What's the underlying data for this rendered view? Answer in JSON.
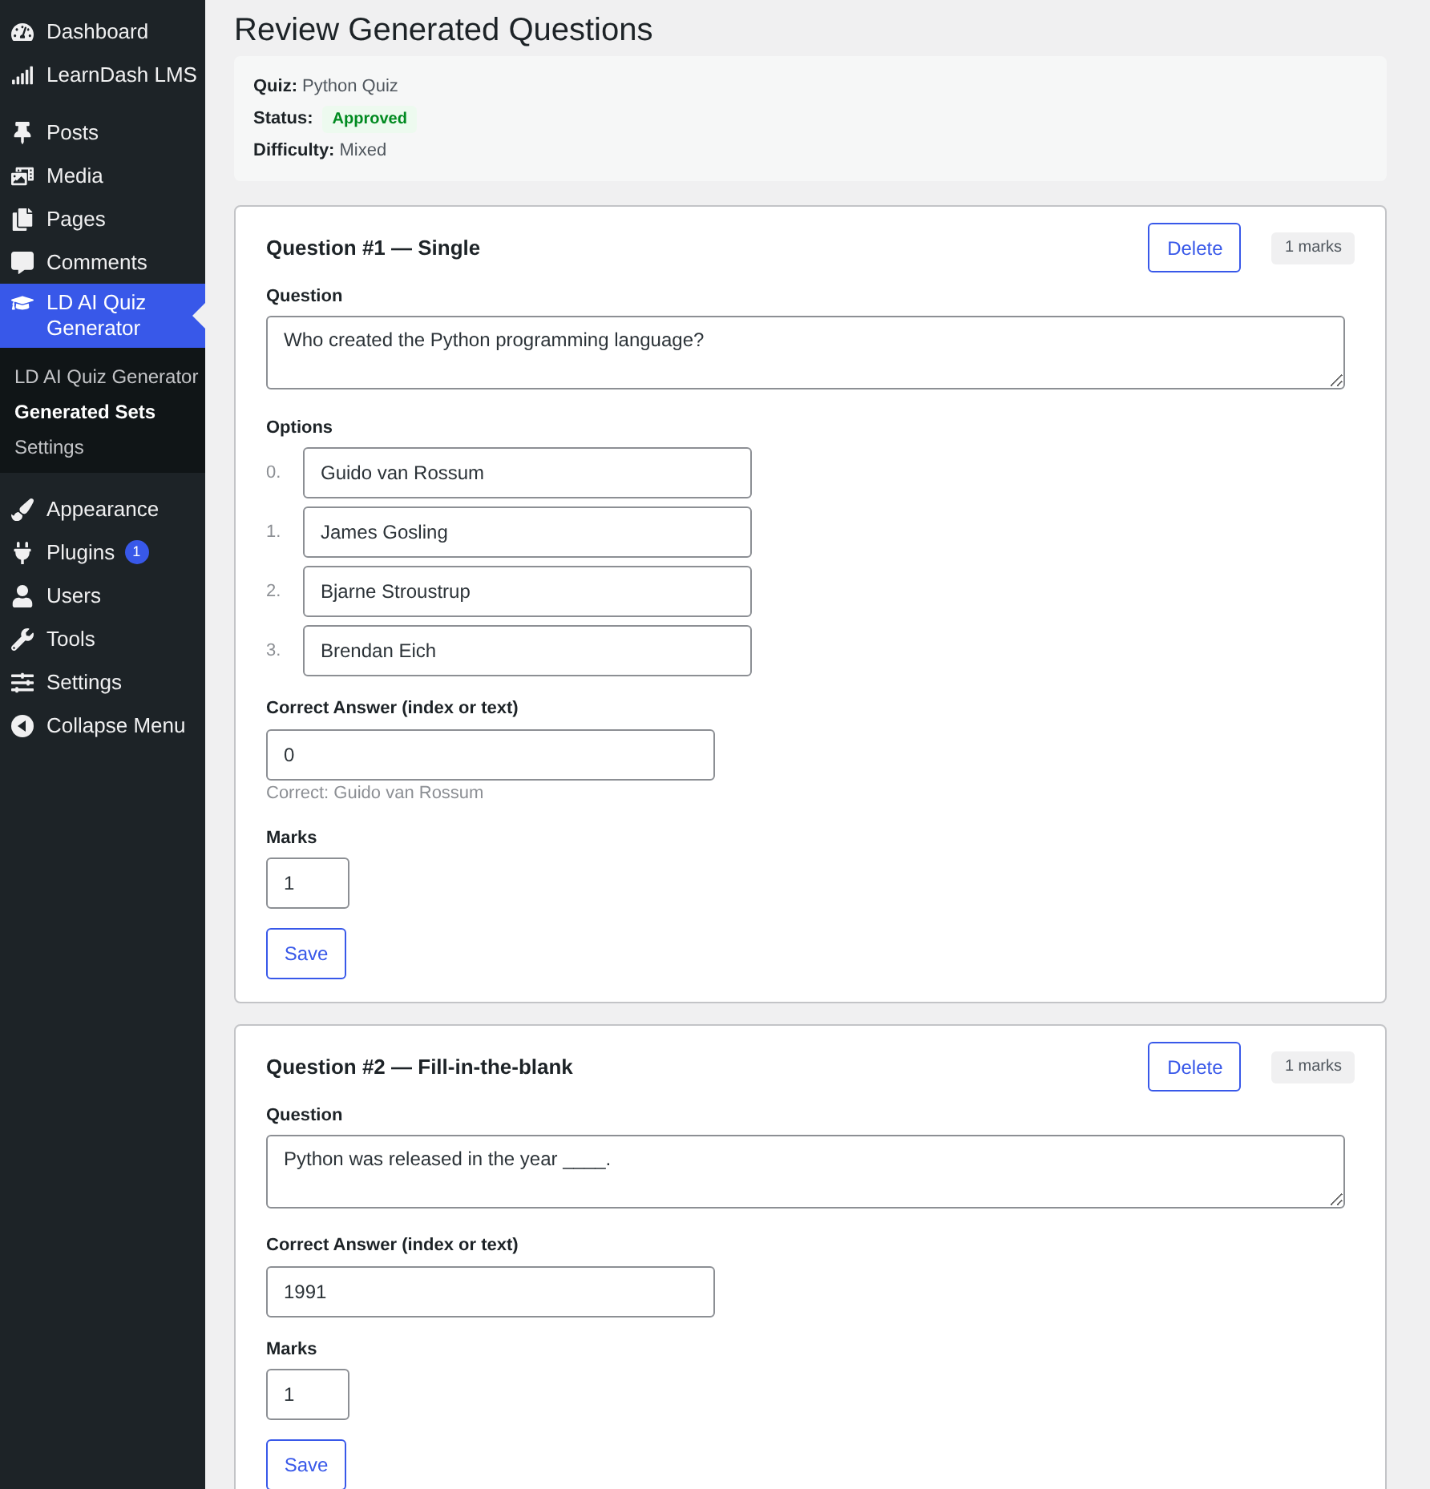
{
  "sidebar": {
    "groups": [
      {
        "items": [
          {
            "label": "Dashboard",
            "selected": false
          },
          {
            "label": "LearnDash LMS",
            "selected": false
          }
        ]
      },
      {
        "items": [
          {
            "label": "Posts",
            "selected": false
          },
          {
            "label": "Media",
            "selected": false
          },
          {
            "label": "Pages",
            "selected": false
          },
          {
            "label": "Comments",
            "selected": false
          },
          {
            "label": "LD AI Quiz Generator",
            "selected": true,
            "submenu": [
              {
                "label": "LD AI Quiz Generator",
                "selected": false
              },
              {
                "label": "Generated Sets",
                "selected": true
              },
              {
                "label": "Settings",
                "selected": false
              }
            ]
          }
        ]
      },
      {
        "items": [
          {
            "label": "Appearance",
            "selected": false
          },
          {
            "label": "Plugins",
            "selected": false,
            "badge": "1"
          },
          {
            "label": "Users",
            "selected": false
          },
          {
            "label": "Tools",
            "selected": false
          },
          {
            "label": "Settings",
            "selected": false
          }
        ]
      }
    ],
    "collapse": "Collapse Menu"
  },
  "page": {
    "title": "Review Generated Questions"
  },
  "summary": {
    "fields": [
      {
        "label": "Quiz:",
        "value": "Python Quiz",
        "kind": "text"
      },
      {
        "label": "Status:",
        "value": "Approved",
        "kind": "badge"
      },
      {
        "label": "Difficulty:",
        "value": "Mixed",
        "kind": "text"
      }
    ]
  },
  "questions": [
    {
      "title": "Question #1 — Single",
      "delete": "Delete",
      "marks_badge": "1 marks",
      "question_label": "Question",
      "question_text": "Who created the Python programming language?",
      "options_label": "Options",
      "options": [
        {
          "index": "0.",
          "value": "Guido van Rossum"
        },
        {
          "index": "1.",
          "value": "James Gosling"
        },
        {
          "index": "2.",
          "value": "Bjarne Stroustrup"
        },
        {
          "index": "3.",
          "value": "Brendan Eich"
        }
      ],
      "answer_label": "Correct Answer (index or text)",
      "answer": "0",
      "answer_hint": "Correct: Guido van Rossum",
      "marks_label": "Marks",
      "marks": "1",
      "save": "Save"
    },
    {
      "title": "Question #2 — Fill-in-the-blank",
      "delete": "Delete",
      "marks_badge": "1 marks",
      "question_label": "Question",
      "question_text": "Python was released in the year ____.",
      "answer_label": "Correct Answer (index or text)",
      "answer": "1991",
      "marks_label": "Marks",
      "marks": "1",
      "save": "Save"
    }
  ]
}
